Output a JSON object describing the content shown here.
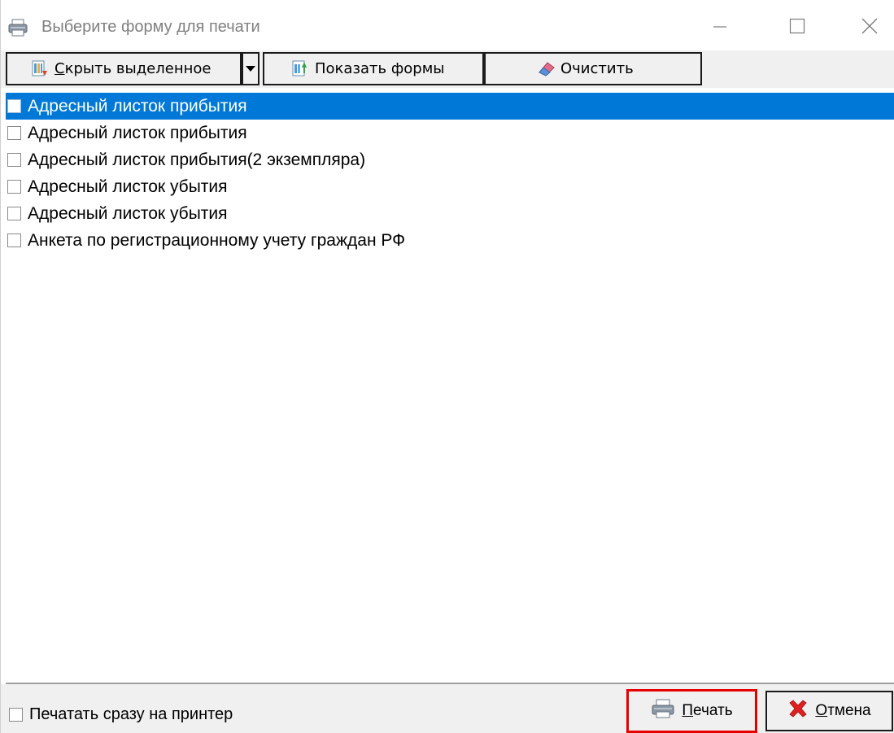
{
  "window": {
    "title": "Выберите форму для печати",
    "icon": "printer-icon"
  },
  "toolbar": {
    "hide_selected": {
      "label_first": "С",
      "label_rest": "крыть выделенное",
      "icon": "hide-forms-icon"
    },
    "dropdown": {
      "icon": "caret-down-icon"
    },
    "show_forms": {
      "label": "Показать формы",
      "icon": "show-forms-icon"
    },
    "clear": {
      "label": "Очистить",
      "icon": "eraser-icon"
    }
  },
  "list": {
    "items": [
      {
        "label": "Адресный листок прибытия",
        "checked": false,
        "selected": true
      },
      {
        "label": "Адресный листок прибытия",
        "checked": false,
        "selected": false
      },
      {
        "label": "Адресный листок прибытия(2 экземпляра)",
        "checked": false,
        "selected": false
      },
      {
        "label": "Адресный листок убытия",
        "checked": false,
        "selected": false
      },
      {
        "label": "Адресный листок убытия",
        "checked": false,
        "selected": false
      },
      {
        "label": "Анкета по регистрационному учету граждан РФ",
        "checked": false,
        "selected": false
      }
    ]
  },
  "footer": {
    "print_direct": {
      "label": "Печатать сразу на принтер",
      "checked": false
    },
    "print_button": {
      "label_first": "П",
      "label_rest": "ечать",
      "icon": "printer-icon"
    },
    "cancel_button": {
      "label_first": "О",
      "label_rest": "тмена",
      "icon": "cancel-x-icon"
    }
  },
  "colors": {
    "selection": "#0078d7",
    "highlight_border": "#e60000",
    "toolbar_bg": "#f0f0f0"
  }
}
